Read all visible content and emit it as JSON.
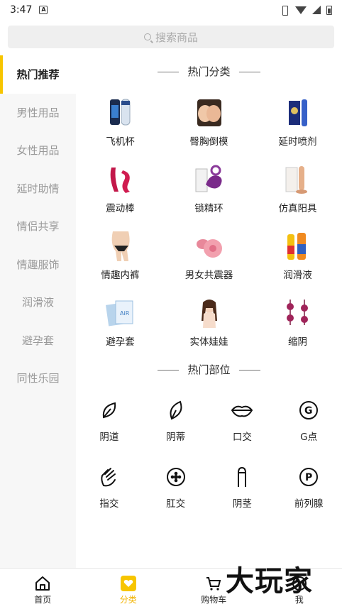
{
  "status_bar": {
    "time": "3:47"
  },
  "search": {
    "placeholder": "搜索商品"
  },
  "sidebar": {
    "items": [
      {
        "label": "热门推荐",
        "active": true
      },
      {
        "label": "男性用品"
      },
      {
        "label": "女性用品"
      },
      {
        "label": "延时助情"
      },
      {
        "label": "情侣共享"
      },
      {
        "label": "情趣服饰"
      },
      {
        "label": "润滑液"
      },
      {
        "label": "避孕套"
      },
      {
        "label": "同性乐园"
      }
    ]
  },
  "hot_categories": {
    "title": "热门分类",
    "items": [
      {
        "label": "飞机杯",
        "icon": "product-thumb"
      },
      {
        "label": "臀胸倒模",
        "icon": "product-thumb"
      },
      {
        "label": "延时喷剂",
        "icon": "product-thumb"
      },
      {
        "label": "震动棒",
        "icon": "product-thumb"
      },
      {
        "label": "锁精环",
        "icon": "product-thumb"
      },
      {
        "label": "仿真阳具",
        "icon": "product-thumb"
      },
      {
        "label": "情趣内裤",
        "icon": "product-thumb"
      },
      {
        "label": "男女共震器",
        "icon": "product-thumb"
      },
      {
        "label": "润滑液",
        "icon": "product-thumb"
      },
      {
        "label": "避孕套",
        "icon": "product-thumb"
      },
      {
        "label": "实体娃娃",
        "icon": "product-thumb"
      },
      {
        "label": "缩阴",
        "icon": "product-thumb"
      }
    ]
  },
  "hot_parts": {
    "title": "热门部位",
    "items": [
      {
        "label": "阴道",
        "icon": "leaf-outline-icon"
      },
      {
        "label": "阴蒂",
        "icon": "leaf-outline-icon"
      },
      {
        "label": "口交",
        "icon": "lips-icon"
      },
      {
        "label": "G点",
        "icon": "letter-g-circle-icon"
      },
      {
        "label": "指交",
        "icon": "hand-icon"
      },
      {
        "label": "肛交",
        "icon": "flower-circle-icon"
      },
      {
        "label": "阴茎",
        "icon": "shaft-icon"
      },
      {
        "label": "前列腺",
        "icon": "letter-p-circle-icon"
      }
    ]
  },
  "tabbar": {
    "items": [
      {
        "label": "首页",
        "icon": "home-icon"
      },
      {
        "label": "分类",
        "icon": "category-icon",
        "active": true
      },
      {
        "label": "购物车",
        "icon": "cart-icon"
      },
      {
        "label": "我",
        "icon": "user-icon"
      }
    ]
  },
  "watermark": {
    "text": "大玩家"
  },
  "colors": {
    "accent": "#f7c500",
    "accent_text": "#f2b400",
    "sidebar_bg": "#f7f7f7"
  }
}
